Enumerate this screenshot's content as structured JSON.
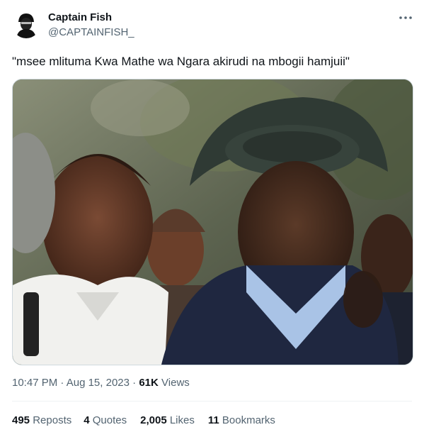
{
  "author": {
    "name": "Captain Fish",
    "handle": "@CAPTAINFISH_"
  },
  "tweet": {
    "text": "\"msee mlituma Kwa Mathe wa Ngara akirudi na mbogii hamjuii\""
  },
  "meta": {
    "time": "10:47 PM",
    "separator": "·",
    "date": "Aug 15, 2023",
    "views_count": "61K",
    "views_label": "Views"
  },
  "stats": {
    "reposts": {
      "count": "495",
      "label": "Reposts"
    },
    "quotes": {
      "count": "4",
      "label": "Quotes"
    },
    "likes": {
      "count": "2,005",
      "label": "Likes"
    },
    "bookmarks": {
      "count": "11",
      "label": "Bookmarks"
    }
  },
  "icons": {
    "more": "more-horizontal-icon",
    "avatar": "masked-avatar"
  },
  "colors": {
    "text_primary": "#0f1419",
    "text_secondary": "#536471",
    "divider": "#eff3f4"
  }
}
